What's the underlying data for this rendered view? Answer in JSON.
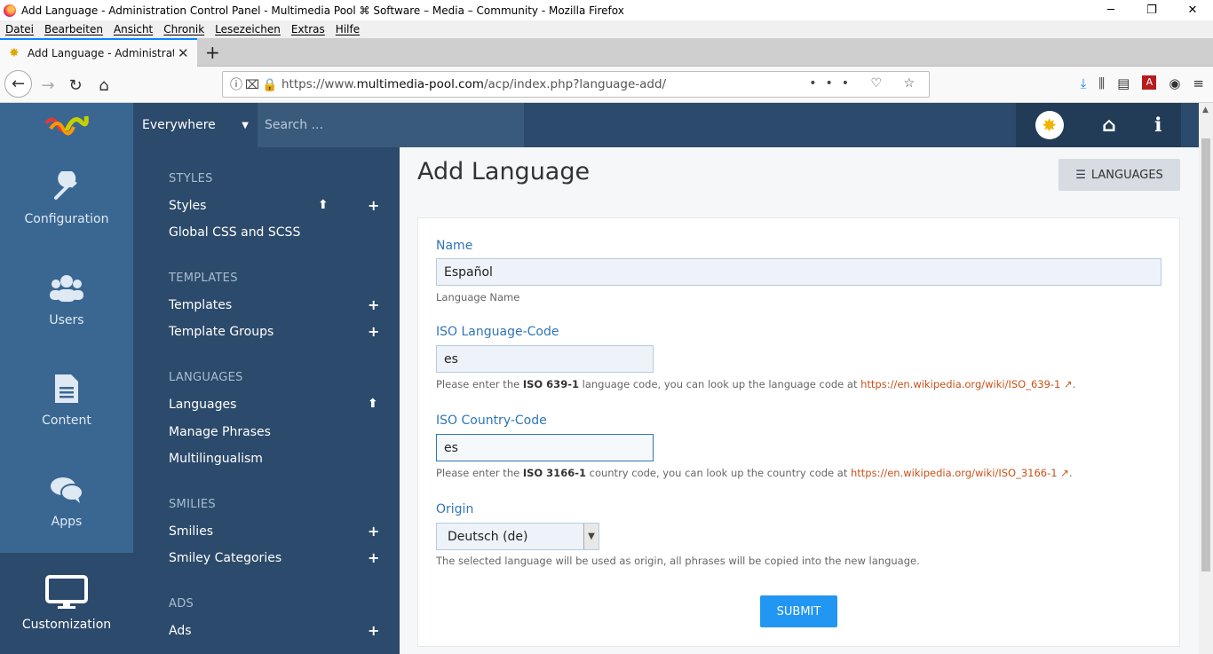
{
  "window": {
    "title": "Add Language - Administration Control Panel - Multimedia Pool ⌘ Software – Media – Community - Mozilla Firefox",
    "minimize": "─",
    "restore": "❐",
    "close": "✕"
  },
  "menubar": [
    "Datei",
    "Bearbeiten",
    "Ansicht",
    "Chronik",
    "Lesezeichen",
    "Extras",
    "Hilfe"
  ],
  "tab": {
    "title": "Add Language - Administration",
    "close": "✕",
    "new_tab": "+"
  },
  "nav": {
    "back": "←",
    "forward": "→",
    "reload": "↻",
    "home": "⌂",
    "url_prefix": "https://www.",
    "url_domain": "multimedia-pool.com",
    "url_path": "/acp/index.php?language-add/",
    "url_right_icons": "••• ♡ ☆"
  },
  "header": {
    "search_scope": "Everywhere",
    "search_placeholder": "Search ..."
  },
  "mainnav": {
    "items": [
      {
        "label": "Configuration",
        "icon": "wrench-icon"
      },
      {
        "label": "Users",
        "icon": "users-icon"
      },
      {
        "label": "Content",
        "icon": "document-icon"
      },
      {
        "label": "Apps",
        "icon": "chat-icon"
      },
      {
        "label": "Customization",
        "icon": "monitor-icon",
        "active": true
      }
    ]
  },
  "subnav": {
    "styles_header": "STYLES",
    "styles": "Styles",
    "global_css": "Global CSS and SCSS",
    "templates_header": "TEMPLATES",
    "templates": "Templates",
    "template_groups": "Template Groups",
    "languages_header": "LANGUAGES",
    "languages": "Languages",
    "manage_phrases": "Manage Phrases",
    "multilingualism": "Multilingualism",
    "smilies_header": "SMILIES",
    "smilies": "Smilies",
    "smiley_categories": "Smiley Categories",
    "ads_header": "ADS",
    "ads": "Ads"
  },
  "content": {
    "title": "Add Language",
    "languages_button": "LANGUAGES",
    "name_label": "Name",
    "name_value": "Español",
    "name_help": "Language Name",
    "iso_lang_label": "ISO Language-Code",
    "iso_lang_value": "es",
    "iso_lang_help_1": "Please enter the ",
    "iso_lang_help_bold": "ISO 639-1",
    "iso_lang_help_2": " language code, you can look up the language code at ",
    "iso_lang_help_link": "https://en.wikipedia.org/wiki/ISO_639-1",
    "iso_country_label": "ISO Country-Code",
    "iso_country_value": "es",
    "iso_country_help_1": "Please enter the ",
    "iso_country_help_bold": "ISO 3166-1",
    "iso_country_help_2": " country code, you can look up the country code at ",
    "iso_country_help_link": "https://en.wikipedia.org/wiki/ISO_3166-1",
    "origin_label": "Origin",
    "origin_value": "Deutsch (de)",
    "origin_help": "The selected language will be used as origin, all phrases will be copied into the new language.",
    "submit": "SUBMIT",
    "period": "."
  },
  "colors": {
    "header": "#2c4a6b",
    "mainnav": "#3a6792",
    "accent": "#2196f3",
    "label": "#2f76b5",
    "link": "#c7521a"
  }
}
